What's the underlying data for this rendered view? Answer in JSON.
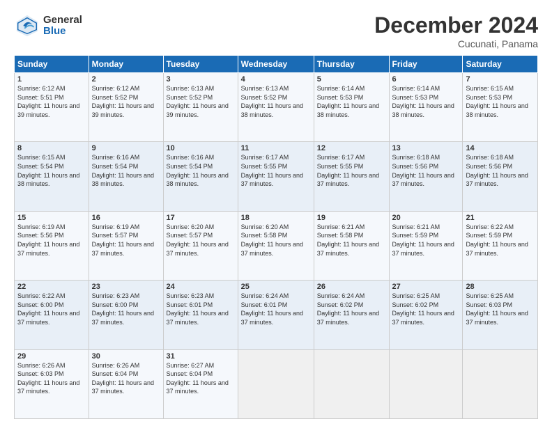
{
  "header": {
    "logo_general": "General",
    "logo_blue": "Blue",
    "month": "December 2024",
    "location": "Cucunati, Panama"
  },
  "days_of_week": [
    "Sunday",
    "Monday",
    "Tuesday",
    "Wednesday",
    "Thursday",
    "Friday",
    "Saturday"
  ],
  "weeks": [
    [
      {
        "day": "1",
        "sunrise": "6:12 AM",
        "sunset": "5:51 PM",
        "daylight": "11 hours and 39 minutes."
      },
      {
        "day": "2",
        "sunrise": "6:12 AM",
        "sunset": "5:52 PM",
        "daylight": "11 hours and 39 minutes."
      },
      {
        "day": "3",
        "sunrise": "6:13 AM",
        "sunset": "5:52 PM",
        "daylight": "11 hours and 39 minutes."
      },
      {
        "day": "4",
        "sunrise": "6:13 AM",
        "sunset": "5:52 PM",
        "daylight": "11 hours and 38 minutes."
      },
      {
        "day": "5",
        "sunrise": "6:14 AM",
        "sunset": "5:53 PM",
        "daylight": "11 hours and 38 minutes."
      },
      {
        "day": "6",
        "sunrise": "6:14 AM",
        "sunset": "5:53 PM",
        "daylight": "11 hours and 38 minutes."
      },
      {
        "day": "7",
        "sunrise": "6:15 AM",
        "sunset": "5:53 PM",
        "daylight": "11 hours and 38 minutes."
      }
    ],
    [
      {
        "day": "8",
        "sunrise": "6:15 AM",
        "sunset": "5:54 PM",
        "daylight": "11 hours and 38 minutes."
      },
      {
        "day": "9",
        "sunrise": "6:16 AM",
        "sunset": "5:54 PM",
        "daylight": "11 hours and 38 minutes."
      },
      {
        "day": "10",
        "sunrise": "6:16 AM",
        "sunset": "5:54 PM",
        "daylight": "11 hours and 38 minutes."
      },
      {
        "day": "11",
        "sunrise": "6:17 AM",
        "sunset": "5:55 PM",
        "daylight": "11 hours and 37 minutes."
      },
      {
        "day": "12",
        "sunrise": "6:17 AM",
        "sunset": "5:55 PM",
        "daylight": "11 hours and 37 minutes."
      },
      {
        "day": "13",
        "sunrise": "6:18 AM",
        "sunset": "5:56 PM",
        "daylight": "11 hours and 37 minutes."
      },
      {
        "day": "14",
        "sunrise": "6:18 AM",
        "sunset": "5:56 PM",
        "daylight": "11 hours and 37 minutes."
      }
    ],
    [
      {
        "day": "15",
        "sunrise": "6:19 AM",
        "sunset": "5:56 PM",
        "daylight": "11 hours and 37 minutes."
      },
      {
        "day": "16",
        "sunrise": "6:19 AM",
        "sunset": "5:57 PM",
        "daylight": "11 hours and 37 minutes."
      },
      {
        "day": "17",
        "sunrise": "6:20 AM",
        "sunset": "5:57 PM",
        "daylight": "11 hours and 37 minutes."
      },
      {
        "day": "18",
        "sunrise": "6:20 AM",
        "sunset": "5:58 PM",
        "daylight": "11 hours and 37 minutes."
      },
      {
        "day": "19",
        "sunrise": "6:21 AM",
        "sunset": "5:58 PM",
        "daylight": "11 hours and 37 minutes."
      },
      {
        "day": "20",
        "sunrise": "6:21 AM",
        "sunset": "5:59 PM",
        "daylight": "11 hours and 37 minutes."
      },
      {
        "day": "21",
        "sunrise": "6:22 AM",
        "sunset": "5:59 PM",
        "daylight": "11 hours and 37 minutes."
      }
    ],
    [
      {
        "day": "22",
        "sunrise": "6:22 AM",
        "sunset": "6:00 PM",
        "daylight": "11 hours and 37 minutes."
      },
      {
        "day": "23",
        "sunrise": "6:23 AM",
        "sunset": "6:00 PM",
        "daylight": "11 hours and 37 minutes."
      },
      {
        "day": "24",
        "sunrise": "6:23 AM",
        "sunset": "6:01 PM",
        "daylight": "11 hours and 37 minutes."
      },
      {
        "day": "25",
        "sunrise": "6:24 AM",
        "sunset": "6:01 PM",
        "daylight": "11 hours and 37 minutes."
      },
      {
        "day": "26",
        "sunrise": "6:24 AM",
        "sunset": "6:02 PM",
        "daylight": "11 hours and 37 minutes."
      },
      {
        "day": "27",
        "sunrise": "6:25 AM",
        "sunset": "6:02 PM",
        "daylight": "11 hours and 37 minutes."
      },
      {
        "day": "28",
        "sunrise": "6:25 AM",
        "sunset": "6:03 PM",
        "daylight": "11 hours and 37 minutes."
      }
    ],
    [
      {
        "day": "29",
        "sunrise": "6:26 AM",
        "sunset": "6:03 PM",
        "daylight": "11 hours and 37 minutes."
      },
      {
        "day": "30",
        "sunrise": "6:26 AM",
        "sunset": "6:04 PM",
        "daylight": "11 hours and 37 minutes."
      },
      {
        "day": "31",
        "sunrise": "6:27 AM",
        "sunset": "6:04 PM",
        "daylight": "11 hours and 37 minutes."
      },
      null,
      null,
      null,
      null
    ]
  ],
  "labels": {
    "sunrise": "Sunrise:",
    "sunset": "Sunset:",
    "daylight": "Daylight:"
  }
}
